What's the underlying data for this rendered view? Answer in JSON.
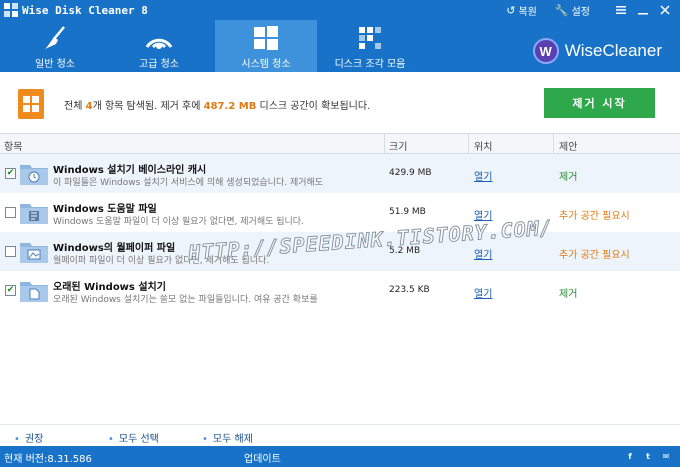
{
  "titlebar": {
    "title": "Wise Disk Cleaner 8",
    "restore_label": "복원",
    "settings_label": "설정",
    "restore_icon": "restore-icon",
    "settings_icon": "wrench-icon"
  },
  "nav": {
    "tabs": [
      {
        "label": "일반 청소",
        "icon": "broom-icon",
        "active": false
      },
      {
        "label": "고급 청소",
        "icon": "deep-clean-icon",
        "active": false
      },
      {
        "label": "시스템 청소",
        "icon": "windows-logo-icon",
        "active": true
      },
      {
        "label": "디스크 조각 모음",
        "icon": "defrag-icon",
        "active": false
      }
    ],
    "brand": {
      "logo_letter": "W",
      "name": "WiseCleaner"
    }
  },
  "summary": {
    "text_before": "전체 ",
    "count": "4",
    "text_middle": "개 항목 탐색됨. 제거 후에 ",
    "size": "487.2 MB",
    "text_after": " 디스크 공간이 확보됩니다.",
    "start_button": "제거 시작"
  },
  "columns": {
    "item": "항목",
    "size": "크기",
    "location": "위치",
    "suggestion": "제안"
  },
  "rows": [
    {
      "checked": true,
      "title": "Windows 설치기 베이스라인 캐시",
      "desc": "이 파일들은 Windows 설치기 서비스에 의해 생성되었습니다. 제거해도",
      "size": "429.9 MB",
      "open": "열기",
      "suggestion": "제거",
      "suggestion_color": "#2a8a2a",
      "icon": "clock-folder-icon"
    },
    {
      "checked": false,
      "title": "Windows 도움말 파일",
      "desc": "Windows 도움말 파일이 더 이상 필요가 없다면, 제거해도 됩니다.",
      "size": "51.9 MB",
      "open": "열기",
      "suggestion": "추가 공간 필요시",
      "suggestion_color": "#e07a12",
      "icon": "help-file-folder-icon"
    },
    {
      "checked": false,
      "title": "Windows의 월페이퍼 파일",
      "desc": "월페이퍼 파일이 더 이상 필요가 없다면, 제거해도 됩니다.",
      "size": "5.2 MB",
      "open": "열기",
      "suggestion": "추가 공간 필요시",
      "suggestion_color": "#e07a12",
      "icon": "wallpaper-folder-icon"
    },
    {
      "checked": true,
      "title": "오래된 Windows 설치기",
      "desc": "오래된 Windows 설치기는 쓸모 없는 파일들입니다. 여유 공간 확보를",
      "size": "223.5 KB",
      "open": "열기",
      "suggestion": "제거",
      "suggestion_color": "#2a8a2a",
      "icon": "installer-folder-icon"
    }
  ],
  "watermark": "HTTP://SPEEDINK.TISTORY.COM/",
  "bottom_links": {
    "recommend": "권장",
    "select_all": "모두 선택",
    "deselect_all": "모두 해제"
  },
  "status": {
    "version": "현재 버전:8.31.586",
    "update": "업데이트",
    "social": [
      {
        "icon": "facebook-icon",
        "glyph": "f"
      },
      {
        "icon": "twitter-icon",
        "glyph": "t"
      },
      {
        "icon": "feedback-icon",
        "glyph": "✉"
      }
    ]
  },
  "colors": {
    "accent": "#1873c8",
    "active_tab": "#3e92dc",
    "start_button": "#2ea84a",
    "highlight": "#e07a12"
  }
}
